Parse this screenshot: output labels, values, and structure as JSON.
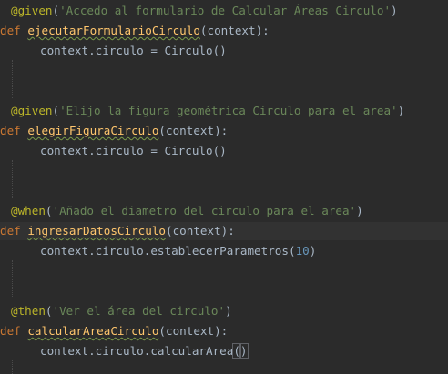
{
  "editor": {
    "language": "python",
    "theme_colors": {
      "background": "#2b2b2b",
      "decorator": "#bbb529",
      "keyword": "#cc7832",
      "function": "#ffc66d",
      "string": "#6a8759",
      "number": "#6897bb",
      "text": "#a9b7c6"
    },
    "steps": [
      {
        "decorator": "@given",
        "open": "(",
        "step_text": "'Accedo al formulario de Calcular Áreas Circulo'",
        "close": ")",
        "def_keyword": "def",
        "function_name": "ejecutarFormularioCirculo",
        "params": "(context):",
        "body_lhs": "context.circulo = ",
        "body_call": "Circulo",
        "body_args_open": "(",
        "body_args_value": "",
        "body_args_close": ")"
      },
      {
        "decorator": "@given",
        "open": "(",
        "step_text": "'Elijo la figura geométrica Circulo para el area'",
        "close": ")",
        "def_keyword": "def",
        "function_name": "elegirFiguraCirculo",
        "params": "(context):",
        "body_lhs": "context.circulo = ",
        "body_call": "Circulo",
        "body_args_open": "(",
        "body_args_value": "",
        "body_args_close": ")"
      },
      {
        "decorator": "@when",
        "open": "(",
        "step_text": "'Añado el diametro del circulo para el area'",
        "close": ")",
        "def_keyword": "def",
        "function_name": "ingresarDatosCirculo",
        "params": "(context):",
        "body_lhs": "context.circulo.",
        "body_call": "establecerParametros",
        "body_args_open": "(",
        "body_args_value": "10",
        "body_args_close": ")"
      },
      {
        "decorator": "@then",
        "open": "(",
        "step_text": "'Ver el área del circulo'",
        "close": ")",
        "def_keyword": "def",
        "function_name": "calcularAreaCirculo",
        "params": "(context):",
        "body_lhs": "context.circulo.",
        "body_call": "calcularArea",
        "body_args_open": "(",
        "body_args_value": "",
        "body_args_close": ")"
      }
    ]
  }
}
